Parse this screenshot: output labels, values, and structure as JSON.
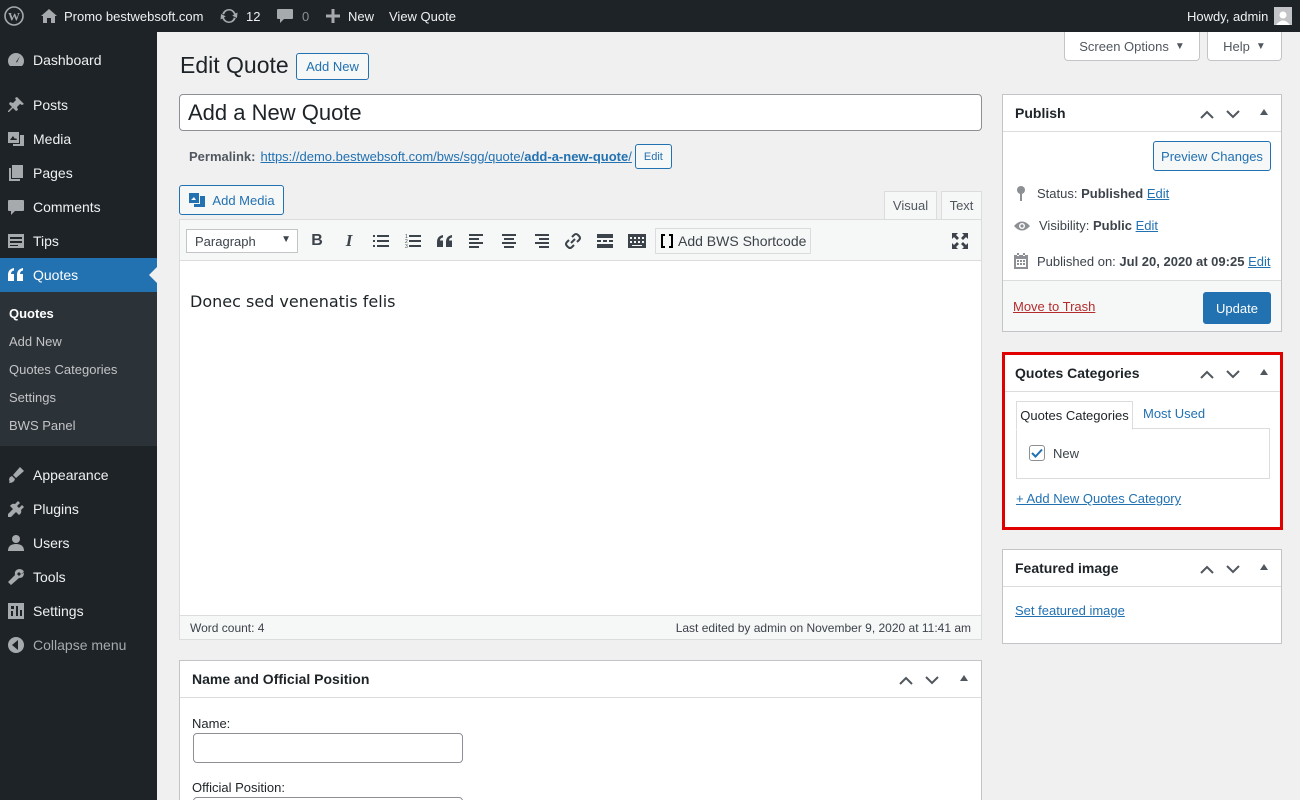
{
  "admin_bar": {
    "site_name": "Promo bestwebsoft.com",
    "updates_count": "12",
    "comments_count": "0",
    "new_label": "New",
    "view_label": "View Quote",
    "howdy": "Howdy, admin"
  },
  "sidebar": {
    "items": [
      {
        "label": "Dashboard",
        "icon": "dashboard-icon"
      },
      {
        "label": "Posts",
        "icon": "pin-icon"
      },
      {
        "label": "Media",
        "icon": "media-icon"
      },
      {
        "label": "Pages",
        "icon": "pages-icon"
      },
      {
        "label": "Comments",
        "icon": "comment-icon"
      },
      {
        "label": "Tips",
        "icon": "tips-icon"
      },
      {
        "label": "Quotes",
        "icon": "quote-icon"
      },
      {
        "label": "Appearance",
        "icon": "brush-icon"
      },
      {
        "label": "Plugins",
        "icon": "plugin-icon"
      },
      {
        "label": "Users",
        "icon": "users-icon"
      },
      {
        "label": "Tools",
        "icon": "wrench-icon"
      },
      {
        "label": "Settings",
        "icon": "settings-icon"
      },
      {
        "label": "Collapse menu",
        "icon": "collapse-icon"
      }
    ],
    "submenu": [
      "Quotes",
      "Add New",
      "Quotes Categories",
      "Settings",
      "BWS Panel"
    ]
  },
  "screen_options": "Screen Options",
  "help": "Help",
  "page": {
    "title": "Edit Quote",
    "add_new": "Add New",
    "post_title": "Add a New Quote",
    "permalink_label": "Permalink:",
    "permalink_base": "https://demo.bestwebsoft.com/bws/sgg/quote/",
    "permalink_slug": "add-a-new-quote",
    "permalink_trailing": "/",
    "edit_label": "Edit"
  },
  "editor": {
    "add_media": "Add Media",
    "tab_visual": "Visual",
    "tab_text": "Text",
    "format_select": "Paragraph",
    "shortcode_label": "Add BWS Shortcode",
    "content": "Donec sed venenatis felis",
    "word_count": "Word count: 4",
    "last_edited": "Last edited by admin on November 9, 2020 at 11:41 am"
  },
  "publish": {
    "title": "Publish",
    "preview": "Preview Changes",
    "status_label": "Status:",
    "status_value": "Published",
    "visibility_label": "Visibility:",
    "visibility_value": "Public",
    "published_label": "Published on:",
    "published_value": "Jul 20, 2020 at 09:25",
    "edit": "Edit",
    "trash": "Move to Trash",
    "update": "Update"
  },
  "categories": {
    "title": "Quotes Categories",
    "tab_all": "Quotes Categories",
    "tab_most_used": "Most Used",
    "items": [
      {
        "label": "New",
        "checked": true
      }
    ],
    "add_new": "+ Add New Quotes Category"
  },
  "featured": {
    "title": "Featured image",
    "link": "Set featured image"
  },
  "name_box": {
    "title": "Name and Official Position",
    "name_label": "Name:",
    "position_label": "Official Position:"
  },
  "colors": {
    "admin_dark": "#1d2327",
    "accent_blue": "#2271b1",
    "highlight_red": "#e00000"
  }
}
